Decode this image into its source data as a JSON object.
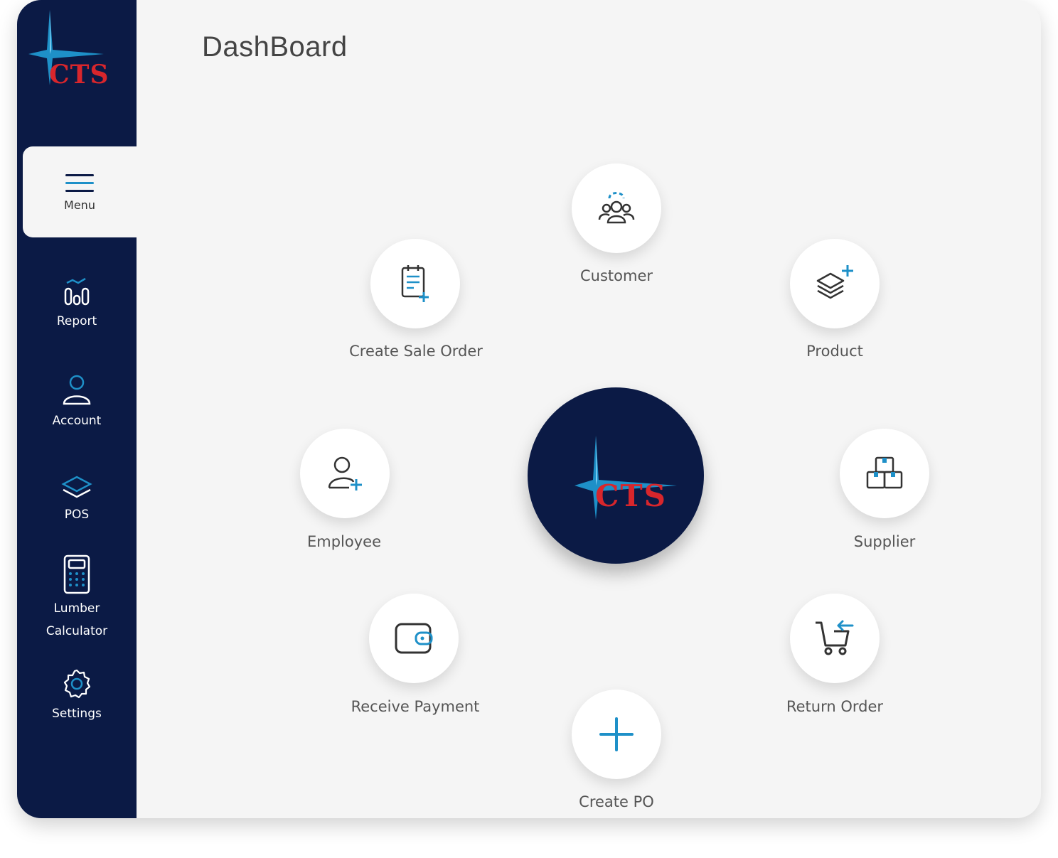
{
  "brand": {
    "logo_text": "CTS"
  },
  "page": {
    "title": "DashBoard"
  },
  "sidebar": {
    "menu_label": "Menu",
    "items": [
      {
        "label": "Report",
        "icon": "report-icon"
      },
      {
        "label": "Account",
        "icon": "account-icon"
      },
      {
        "label": "POS",
        "icon": "pos-icon"
      },
      {
        "label": "Lumber Calculator",
        "icon": "calculator-icon"
      },
      {
        "label": "Settings",
        "icon": "gear-icon"
      }
    ]
  },
  "dashboard": {
    "actions": [
      {
        "label": "Customer",
        "icon": "customer-group-icon"
      },
      {
        "label": "Create Sale Order",
        "icon": "sale-order-icon"
      },
      {
        "label": "Product",
        "icon": "product-add-icon"
      },
      {
        "label": "Employee",
        "icon": "employee-add-icon"
      },
      {
        "label": "Supplier",
        "icon": "supplier-boxes-icon"
      },
      {
        "label": "Receive Payment",
        "icon": "wallet-icon"
      },
      {
        "label": "Return Order",
        "icon": "return-cart-icon"
      },
      {
        "label": "Create PO",
        "icon": "plus-icon"
      }
    ]
  },
  "colors": {
    "sidebar_bg": "#0b1a45",
    "accent_blue": "#1e90c8",
    "logo_red": "#d8262c",
    "content_bg": "#f5f5f5"
  }
}
